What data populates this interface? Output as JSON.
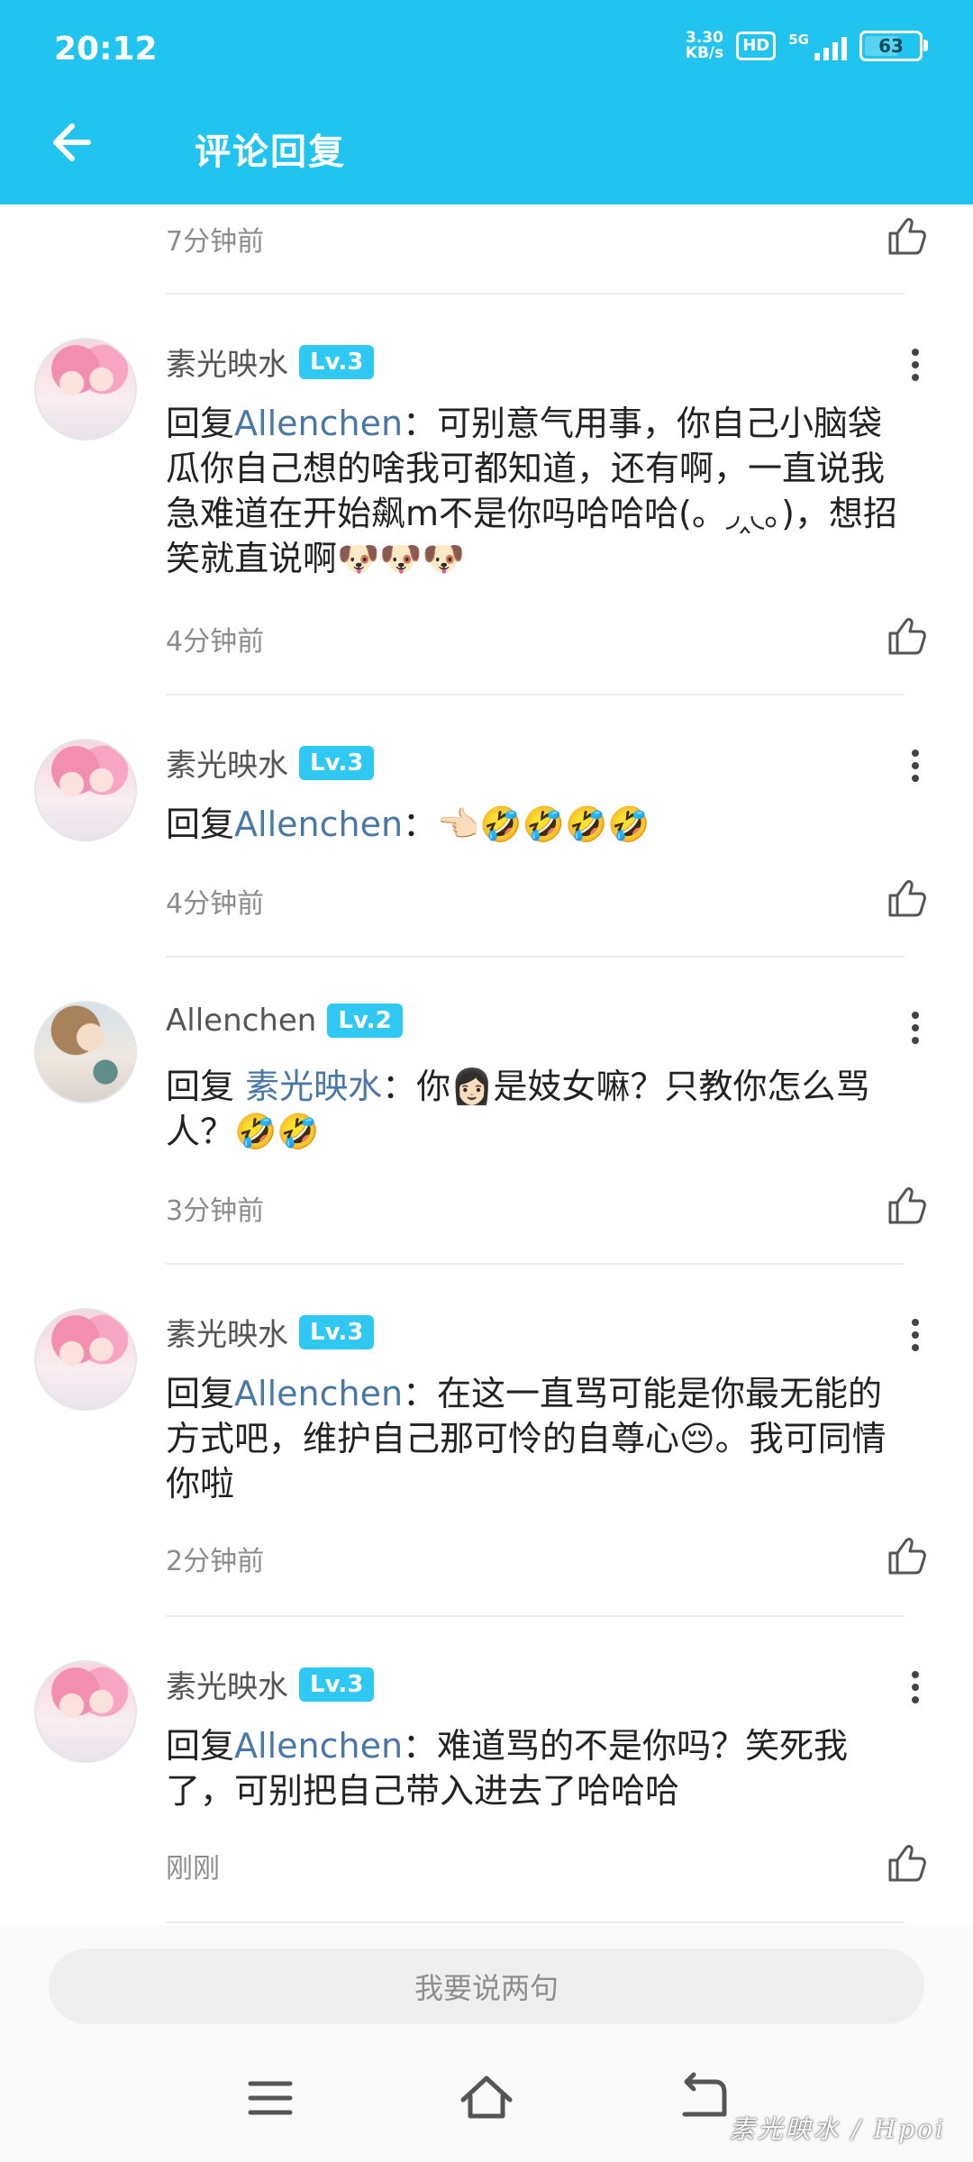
{
  "status_bar": {
    "time": "20:12",
    "net_speed_top": "3.30",
    "net_speed_bottom": "KB/s",
    "hd": "HD",
    "network": "5G",
    "battery": "63"
  },
  "header": {
    "title": "评论回复",
    "back_icon": "arrow-left-icon",
    "color": "#21c4ee"
  },
  "top_partial": {
    "time": "7分钟前"
  },
  "comments": [
    {
      "user": "素光映水",
      "level": "Lv.3",
      "reply_prefix": "回复",
      "reply_to": "Allenchen",
      "sep": "：",
      "text": "可别意气用事，你自己小脑袋瓜你自己想的啥我可都知道，还有啊，一直说我急难道在开始飙m不是你吗哈哈哈(。◞‸◟。)，想招笑就直说啊🐶🐶🐶",
      "time": "4分钟前"
    },
    {
      "user": "素光映水",
      "level": "Lv.3",
      "reply_prefix": "回复",
      "reply_to": "Allenchen",
      "sep": "：",
      "text": "👈🏻🤣🤣🤣🤣",
      "time": "4分钟前"
    },
    {
      "user": "Allenchen",
      "level": "Lv.2",
      "reply_prefix": "回复",
      "reply_to": "素光映水",
      "sep": "：",
      "text": "你👩🏻是妓女嘛？只教你怎么骂人？🤣🤣",
      "time": "3分钟前"
    },
    {
      "user": "素光映水",
      "level": "Lv.3",
      "reply_prefix": "回复",
      "reply_to": "Allenchen",
      "sep": "：",
      "text": "在这一直骂可能是你最无能的方式吧，维护自己那可怜的自尊心😔。我可同情你啦",
      "time": "2分钟前"
    },
    {
      "user": "素光映水",
      "level": "Lv.3",
      "reply_prefix": "回复",
      "reply_to": "Allenchen",
      "sep": "：",
      "text": "难道骂的不是你吗？笑死我了，可别把自己带入进去了哈哈哈",
      "time": "刚刚"
    }
  ],
  "bottom": {
    "placeholder": "我要说两句"
  },
  "watermark": "素光映水 / Hpoi"
}
